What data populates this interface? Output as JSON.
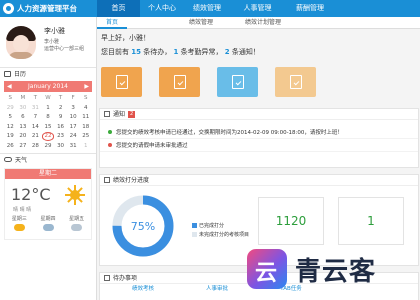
{
  "app": {
    "title": "人力资源管理平台"
  },
  "nav": [
    "首页",
    "个人中心",
    "绩效管理",
    "人事管理",
    "薪酬管理"
  ],
  "subtabs": [
    "首页",
    "绩效管理",
    "绩效计划管理"
  ],
  "profile": {
    "name": "李小雅",
    "role": "李小雅",
    "dept": "运营中心一部三组"
  },
  "sections": {
    "calendar": "日历",
    "weather": "天气"
  },
  "calendar": {
    "month": "January 2014",
    "prev": "◀",
    "next": "▶",
    "weekdays": [
      "S",
      "M",
      "T",
      "W",
      "T",
      "F",
      "S"
    ],
    "days": [
      "29",
      "30",
      "31",
      "1",
      "2",
      "3",
      "4",
      "5",
      "6",
      "7",
      "8",
      "9",
      "10",
      "11",
      "12",
      "13",
      "14",
      "15",
      "16",
      "17",
      "18",
      "19",
      "20",
      "21",
      "22",
      "23",
      "24",
      "25",
      "26",
      "27",
      "28",
      "29",
      "30",
      "31",
      "1"
    ],
    "today": "22"
  },
  "weather": {
    "day_label": "星期二",
    "temp": "12°C",
    "desc": "晴 晴 晴",
    "forecast": [
      "星期三",
      "星期四",
      "星期五"
    ]
  },
  "welcome": {
    "greeting": "早上好，小雅！",
    "line_prefix": "您目前有",
    "pending": "15",
    "pending_label": "条待办，",
    "reminders": "1",
    "reminders_label": "条考勤异常，",
    "notices": "2",
    "notices_label": "条通知！"
  },
  "quick_actions": [
    "clipboard-icon",
    "checklist-icon",
    "edit-icon",
    "badge-icon"
  ],
  "notice_panel": {
    "title": "通知",
    "count": "2",
    "items": [
      "您提交的绩效考核申请已经通过，交换期限时间为2014-02-09 09:00-18:00，请按时上班！",
      "您提交的请假申请未审批通过"
    ]
  },
  "performance": {
    "title": "绩效打分进度",
    "percent_label": "75%",
    "percent": 0.75,
    "legend": [
      "已完成打分",
      "未完成打分的考核项目"
    ],
    "stats": [
      "1120",
      "1"
    ]
  },
  "todo": {
    "title": "待办事项",
    "tabs": [
      "绩效考核",
      "人事审批",
      "TAB任务"
    ]
  },
  "colors": {
    "primary": "#1a8fd6",
    "accent": "#f07a74",
    "progress": "#3b8fe0",
    "stat": "#2d9e3c"
  },
  "watermark": {
    "text": "青云客"
  }
}
